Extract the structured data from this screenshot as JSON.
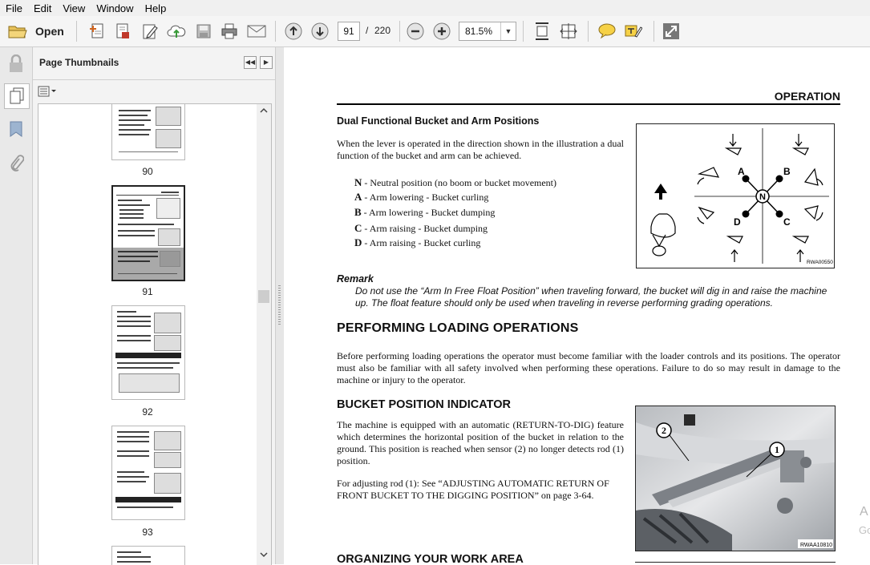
{
  "menu": [
    "File",
    "Edit",
    "View",
    "Window",
    "Help"
  ],
  "toolbar": {
    "open_label": "Open",
    "page_current": "91",
    "page_separator": "/",
    "page_total": "220",
    "zoom": "81.5%",
    "icons": [
      "open-folder-icon",
      "create-pdf-icon",
      "export-pdf-icon",
      "edit-pdf-icon",
      "cloud-upload-icon",
      "save-icon",
      "print-icon",
      "email-icon",
      "previous-page-icon",
      "next-page-icon",
      "zoom-out-icon",
      "zoom-in-icon",
      "fit-page-icon",
      "fit-width-icon",
      "comment-icon",
      "highlight-icon",
      "fullscreen-icon"
    ]
  },
  "sidebar": {
    "title": "Page Thumbnails",
    "thumbnails": [
      {
        "number": "90"
      },
      {
        "number": "91",
        "selected": true
      },
      {
        "number": "92"
      },
      {
        "number": "93"
      }
    ]
  },
  "document": {
    "section_header": "OPERATION",
    "dual_heading": "Dual Functional Bucket and Arm Positions",
    "dual_paragraph": "When the lever is operated in the direction shown in the illustration a dual function of the bucket and arm can be achieved.",
    "legend": [
      {
        "key": "N",
        "text": " - Neutral position (no boom or bucket movement)"
      },
      {
        "key": "A",
        "text": " - Arm lowering - Bucket curling"
      },
      {
        "key": "B",
        "text": " - Arm lowering - Bucket dumping"
      },
      {
        "key": "C",
        "text": " - Arm raising - Bucket dumping"
      },
      {
        "key": "D",
        "text": " - Arm raising - Bucket curling"
      }
    ],
    "diagram": {
      "labels": [
        "A",
        "B",
        "N",
        "D",
        "C"
      ],
      "code": "RWA00550"
    },
    "remark_heading": "Remark",
    "remark_text": "Do not use the “Arm In Free Float Position” when traveling forward, the bucket will dig in and raise the machine up. The float feature should only be used when traveling in reverse performing grading operations.",
    "loading_heading": "PERFORMING LOADING OPERATIONS",
    "loading_paragraph": "Before performing loading operations the operator must become familiar with the loader controls and its positions. The operator must also be familiar with all safety involved when performing these operations. Failure to do so may result in damage to the machine or injury to the operator.",
    "bucket_heading": "BUCKET POSITION INDICATOR",
    "bucket_paragraph1": "The machine is equipped with an automatic (RETURN-TO-DIG) feature which determines the horizontal position of the bucket in relation to the ground. This position is reached when sensor (2) no longer detects rod (1) position.",
    "bucket_paragraph2": "For adjusting rod (1): See “ADJUSTING AUTOMATIC RETURN OF FRONT BUCKET TO THE DIGGING POSITION” on page 3-64.",
    "photo": {
      "callouts": [
        "2",
        "1"
      ],
      "code": "RWAA10810"
    },
    "organize_heading": "ORGANIZING YOUR WORK AREA"
  },
  "watermark": {
    "line1": "A",
    "line2": "Go"
  }
}
